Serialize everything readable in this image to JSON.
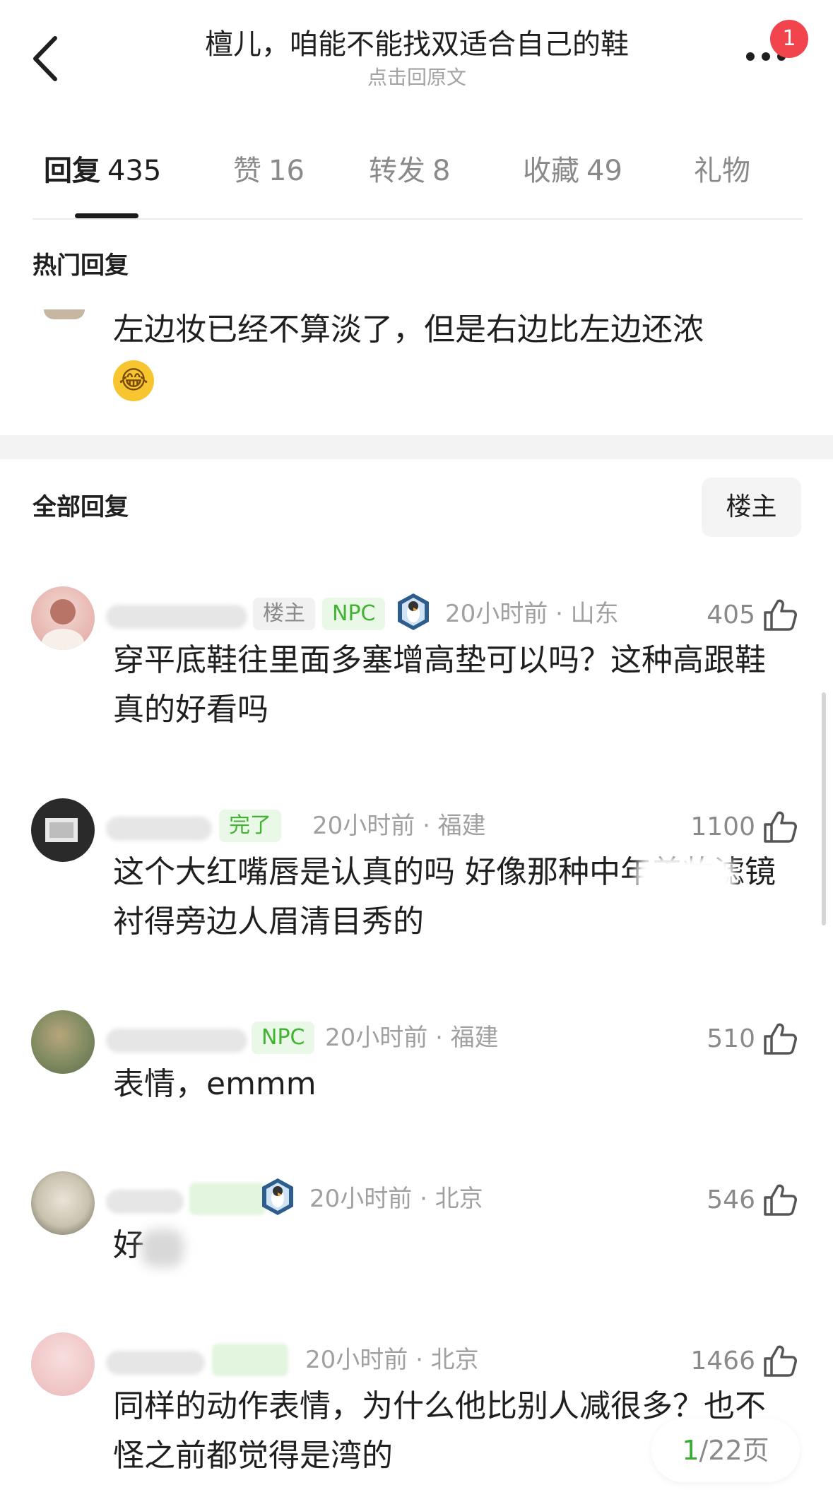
{
  "header": {
    "title": "檀儿，咱能不能找双适合自己的鞋",
    "subtitle": "点击回原文",
    "badge_count": "1"
  },
  "tabs": [
    {
      "label": "回复",
      "count": "435"
    },
    {
      "label": "赞",
      "count": "16"
    },
    {
      "label": "转发",
      "count": "8"
    },
    {
      "label": "收藏",
      "count": "49"
    },
    {
      "label": "礼物",
      "count": ""
    }
  ],
  "hot": {
    "section_title": "热门回复",
    "text": "左边妆已经不算淡了，但是右边比左边还浓",
    "emoji": "😂"
  },
  "all": {
    "section_title": "全部回复",
    "owner_filter": "楼主"
  },
  "comments": [
    {
      "tags": [
        "楼主",
        "NPC"
      ],
      "meta": "20小时前 · 山东",
      "likes": "405",
      "text": "穿平底鞋往里面多塞增高垫可以吗？这种高跟鞋真的好看吗"
    },
    {
      "tags": [
        "完了"
      ],
      "meta": "20小时前 · 福建",
      "likes": "1100",
      "text": "这个大红嘴唇是认真的吗 好像那种中年美妆滤镜 衬得旁边人眉清目秀的"
    },
    {
      "tags": [
        "NPC"
      ],
      "meta": "20小时前 · 福建",
      "likes": "510",
      "text": "表情，emmm"
    },
    {
      "tags": [],
      "meta": "20小时前 · 北京",
      "likes": "546",
      "text": "好"
    },
    {
      "tags": [],
      "meta": "20小时前 · 北京",
      "likes": "1466",
      "text": "同样的动作表情，为什么他比别人减很多？也不怪之前都觉得是湾的"
    }
  ],
  "pager": {
    "current": "1",
    "total_text": "/22页"
  },
  "colors": {
    "accent_green": "#42b233",
    "badge_red": "#f2444c",
    "text_dark": "#1f1f1f",
    "text_gray": "#a0a0a0"
  }
}
